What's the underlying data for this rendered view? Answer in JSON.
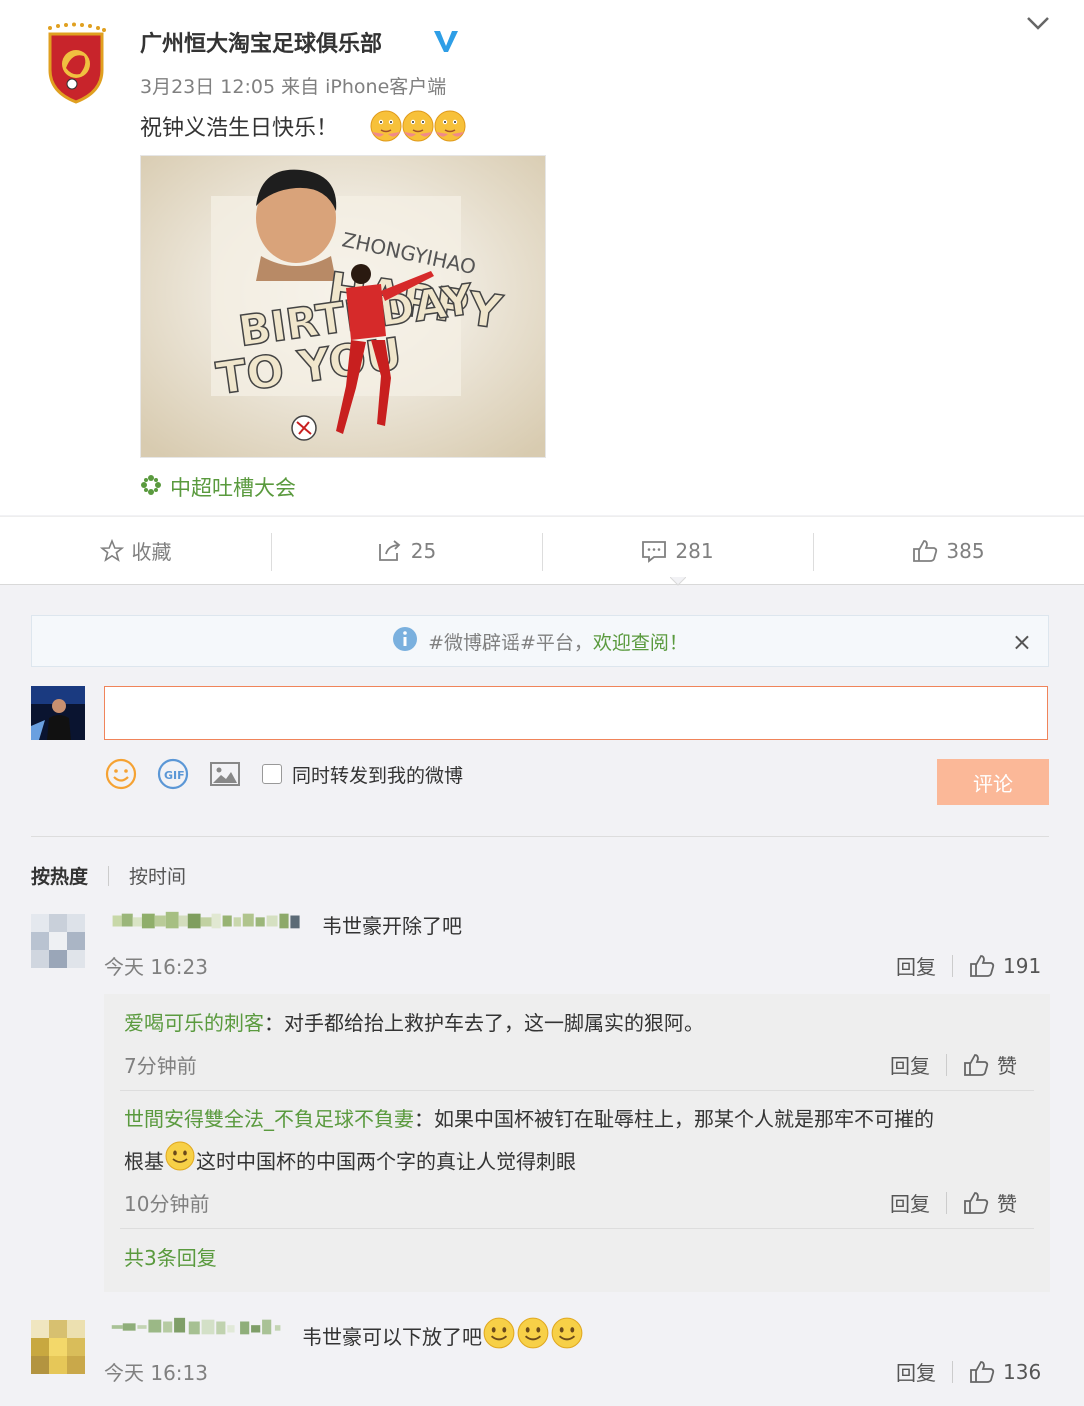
{
  "post": {
    "author": "广州恒大淘宝足球俱乐部",
    "meta": "3月23日 12:05 来自 iPhone客户端",
    "text": "祝钟义浩生日快乐！",
    "image_texts": {
      "name": "ZHONGYIHAO",
      "line1": "HAPPY",
      "line2": "BIRTHDAY",
      "line3": "TO YOU"
    },
    "topic": "中超吐槽大会"
  },
  "actions": {
    "favorite": "收藏",
    "repost_count": "25",
    "comment_count": "281",
    "like_count": "385"
  },
  "notice": {
    "prefix": "#微博辟谣#平台，",
    "link": "欢迎查阅！",
    "close": "×"
  },
  "composer": {
    "input_value": "",
    "repost_label": "同时转发到我的微博",
    "submit_label": "评论"
  },
  "sort": {
    "hot": "按热度",
    "time": "按时间"
  },
  "comments": [
    {
      "text": "韦世豪开除了吧",
      "time": "今天 16:23",
      "reply_label": "回复",
      "likes": "191",
      "replies": [
        {
          "author": "爱喝可乐的刺客",
          "text": "：对手都给抬上救护车去了，这一脚属实的狠阿。",
          "time": "7分钟前",
          "reply_label": "回复",
          "like_label": "赞"
        },
        {
          "author": "世間安得雙全法_不負足球不負妻",
          "text_line1": "：如果中国杯被钉在耻辱柱上，那某个人就是那牢不可摧的",
          "text_line2a": "根基",
          "text_line2b": "这时中国杯的中国两个字的真让人觉得刺眼",
          "time": "10分钟前",
          "reply_label": "回复",
          "like_label": "赞"
        }
      ],
      "more_replies": "共3条回复"
    },
    {
      "text": "韦世豪可以下放了吧",
      "time": "今天 16:13",
      "reply_label": "回复",
      "likes": "136"
    }
  ],
  "colors": {
    "link_green": "#5a9a3e",
    "input_border": "#f0845a",
    "submit_bg": "#fbb898",
    "verified_blue": "#2e9ee6"
  }
}
